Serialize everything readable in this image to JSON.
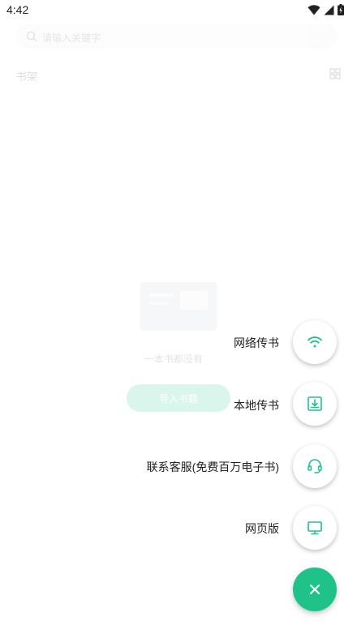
{
  "status_bar": {
    "time": "4:42"
  },
  "background": {
    "search_placeholder": "请输入关键字",
    "shelf_title": "书架",
    "empty_text": "一本书都没有",
    "import_button": "导入书籍"
  },
  "speed_dial": {
    "items": [
      {
        "label": "网络传书",
        "icon": "wifi-icon"
      },
      {
        "label": "本地传书",
        "icon": "download-icon"
      },
      {
        "label": "联系客服(免费百万电子书)",
        "icon": "headset-icon"
      },
      {
        "label": "网页版",
        "icon": "monitor-icon"
      }
    ],
    "close_icon": "close-icon"
  },
  "colors": {
    "accent": "#1fc38a",
    "text": "#222222"
  }
}
